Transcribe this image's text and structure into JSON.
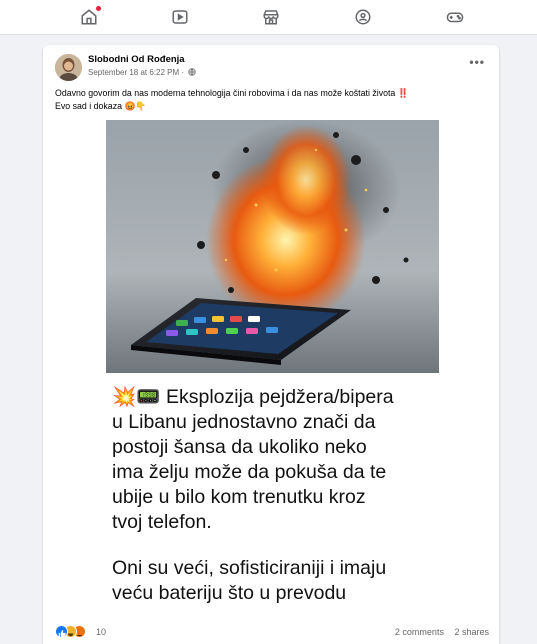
{
  "nav": {
    "items": [
      {
        "name": "home",
        "icon": "home-icon",
        "active": true,
        "has_notification": true
      },
      {
        "name": "watch",
        "icon": "video-icon"
      },
      {
        "name": "marketplace",
        "icon": "store-icon"
      },
      {
        "name": "groups",
        "icon": "groups-icon"
      },
      {
        "name": "gaming",
        "icon": "gamepad-icon"
      }
    ]
  },
  "post": {
    "author": "Slobodni Od Rođenja",
    "timestamp": "September 18 at 6:22 PM",
    "separator": "·",
    "privacy_icon": "globe-icon",
    "more_label": "•••",
    "caption_line1": "Odavno govorim da nas moderna tehnologija čini  robovima i da nas može koštati života ‼️",
    "caption_line2": "Evo sad i dokaza 😡👇",
    "image": {
      "headline": "💥📟 Eksplozija pejdžera/bipera\nu Libanu jednostavno znači da\npostoji šansa da ukoliko neko\nima želju može da pokuša da te\nubije u bilo kom trenutku kroz\ntvoj telefon.",
      "body": "Oni su veći, sofisticiraniji i imaju\nveću bateriju što u prevodu"
    },
    "reactions": {
      "types": [
        "like",
        "haha",
        "angry"
      ],
      "count": "10"
    },
    "comments": "2 comments",
    "shares": "2 shares"
  },
  "colors": {
    "brand": "#1877f2",
    "notification": "#e41e3f",
    "secondary_text": "#65676b"
  }
}
